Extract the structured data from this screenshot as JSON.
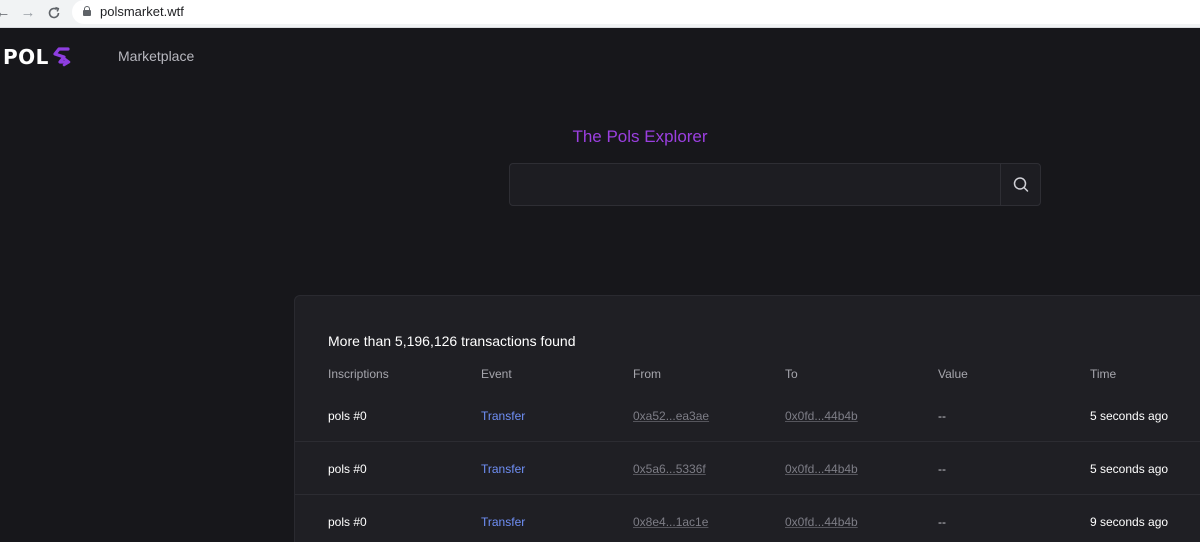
{
  "browser": {
    "url": "polsmarket.wtf"
  },
  "header": {
    "logo_text": "POL",
    "nav_marketplace": "Marketplace",
    "accent": "#9b3fe0"
  },
  "hero": {
    "title": "The Pols Explorer",
    "search_value": ""
  },
  "transactions": {
    "summary": "More than 5,196,126 transactions found",
    "columns": [
      "Inscriptions",
      "Event",
      "From",
      "To",
      "Value",
      "Time"
    ],
    "rows": [
      {
        "inscription": "pols #0",
        "event": "Transfer",
        "from": "0xa52...ea3ae",
        "to": "0x0fd...44b4b",
        "value": "--",
        "time": "5 seconds ago"
      },
      {
        "inscription": "pols #0",
        "event": "Transfer",
        "from": "0x5a6...5336f",
        "to": "0x0fd...44b4b",
        "value": "--",
        "time": "5 seconds ago"
      },
      {
        "inscription": "pols #0",
        "event": "Transfer",
        "from": "0x8e4...1ac1e",
        "to": "0x0fd...44b4b",
        "value": "--",
        "time": "9 seconds ago"
      }
    ]
  }
}
